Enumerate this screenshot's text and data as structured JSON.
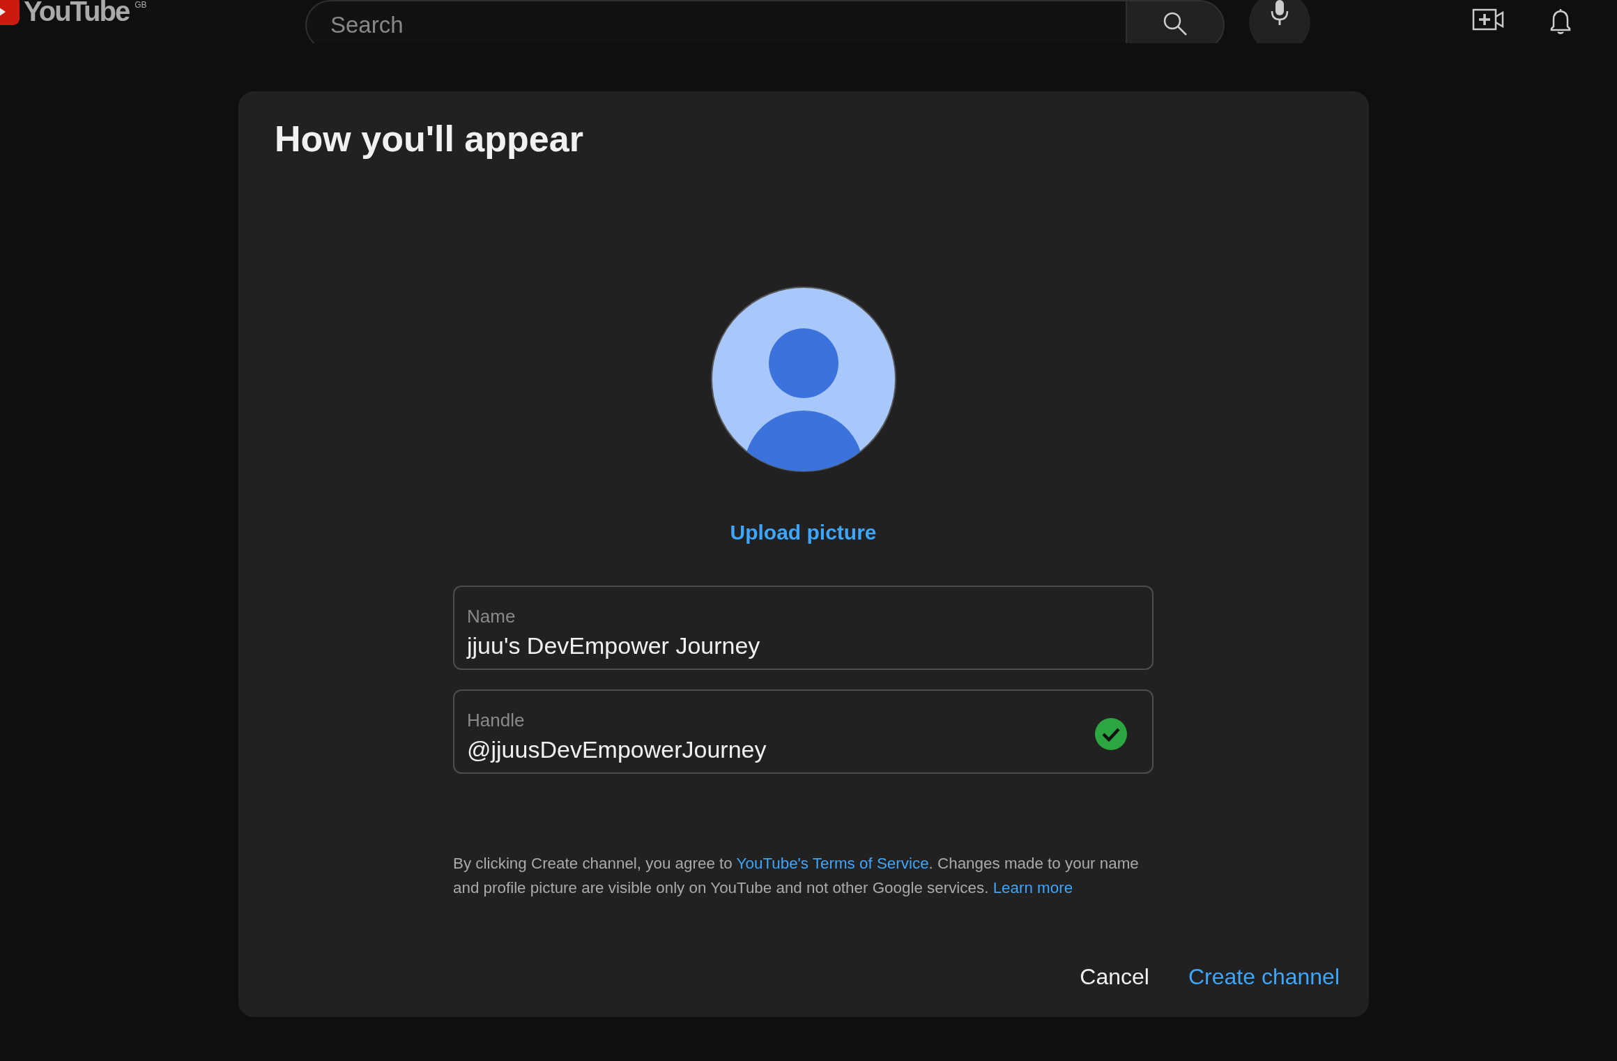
{
  "topbar": {
    "logo": "YouTube",
    "country": "GB",
    "search": {
      "placeholder": "Search"
    }
  },
  "dialog": {
    "title": "How you'll appear",
    "upload_label": "Upload picture",
    "fields": [
      {
        "label": "Name",
        "value": "jjuu's DevEmpower Journey",
        "valid": false
      },
      {
        "label": "Handle",
        "value": "@jjuusDevEmpowerJourney",
        "valid": true
      }
    ],
    "notice": [
      {
        "kind": "text",
        "text": "By clicking Create channel, you agree to "
      },
      {
        "kind": "link",
        "text": "YouTube's Terms of Service"
      },
      {
        "kind": "text",
        "text": ". Changes made to your name and profile picture are visible only on YouTube and not other Google services. "
      },
      {
        "kind": "link",
        "text": "Learn more"
      }
    ],
    "buttons": [
      {
        "label": "Cancel",
        "kind": "secondary"
      },
      {
        "label": "Create channel",
        "kind": "primary"
      }
    ]
  }
}
